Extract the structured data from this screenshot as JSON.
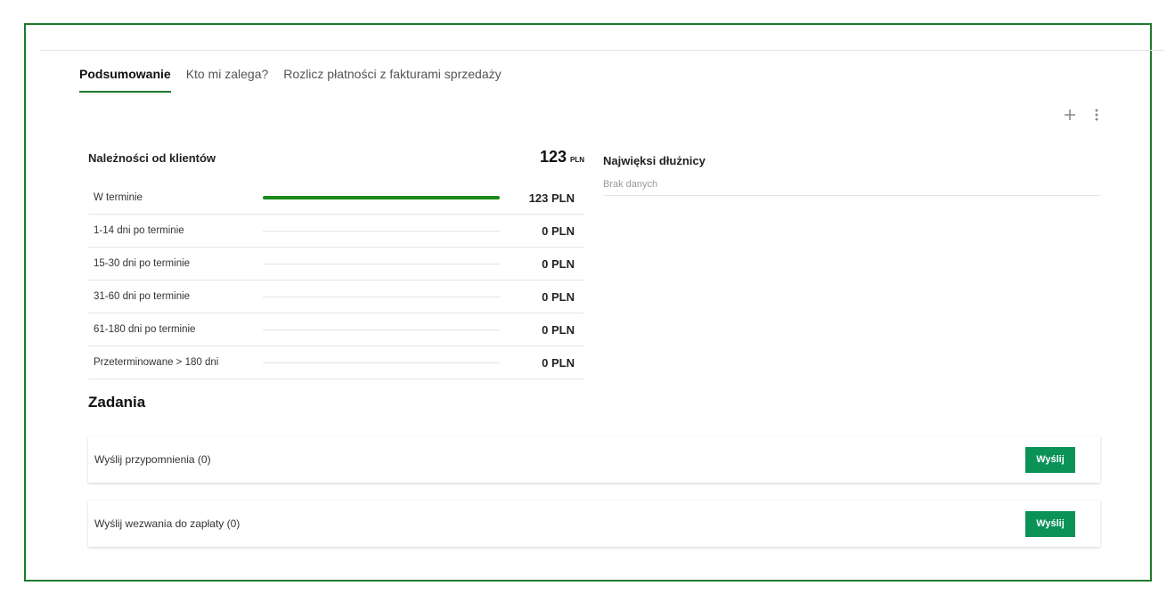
{
  "tabs": [
    {
      "label": "Podsumowanie",
      "active": true
    },
    {
      "label": "Kto mi zalega?",
      "active": false
    },
    {
      "label": "Rozlicz płatności z fakturami sprzedaży",
      "active": false
    }
  ],
  "actions": {
    "add_icon": "plus-icon",
    "more_icon": "kebab-menu-icon"
  },
  "receivables": {
    "title": "Należności od klientów",
    "total_value": "123",
    "total_currency": "PLN",
    "rows": [
      {
        "label": "W terminie",
        "amount": "123 PLN",
        "fill": 1.0
      },
      {
        "label": "1-14 dni po terminie",
        "amount": "0 PLN",
        "fill": 0
      },
      {
        "label": "15-30 dni po terminie",
        "amount": "0 PLN",
        "fill": 0
      },
      {
        "label": "31-60 dni po terminie",
        "amount": "0 PLN",
        "fill": 0
      },
      {
        "label": "61-180 dni po terminie",
        "amount": "0 PLN",
        "fill": 0
      },
      {
        "label": "Przeterminowane > 180 dni",
        "amount": "0 PLN",
        "fill": 0
      }
    ]
  },
  "debtors": {
    "title": "Najwięksi dłużnicy",
    "empty_text": "Brak danych"
  },
  "tasks": {
    "title": "Zadania",
    "items": [
      {
        "label": "Wyślij przypomnienia (0)",
        "button": "Wyślij"
      },
      {
        "label": "Wyślij wezwania do zapłaty (0)",
        "button": "Wyślij"
      }
    ]
  },
  "colors": {
    "accent": "#1f7a2e",
    "bar_fill": "#1a8a1a",
    "button": "#0a9257"
  }
}
